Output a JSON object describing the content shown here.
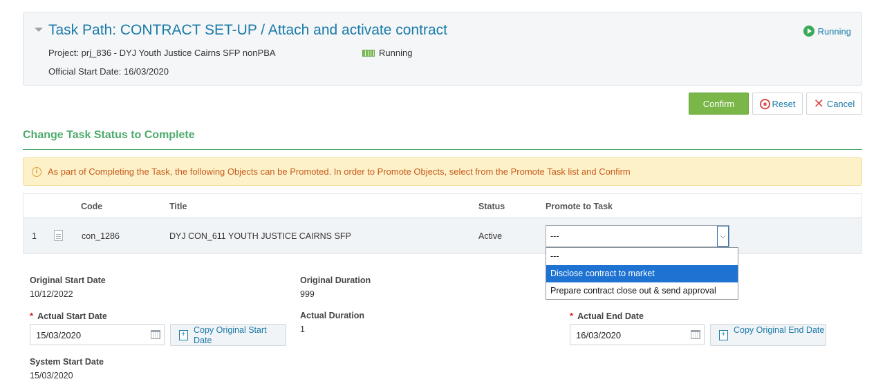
{
  "header": {
    "title": "Task Path: CONTRACT SET-UP / Attach and activate contract",
    "project": "Project: prj_836 - DYJ Youth Justice Cairns SFP nonPBA",
    "official_start": "Official Start Date: 16/03/2020",
    "status_mid": "Running",
    "status_top": "Running",
    "collapse_icon": "chevron-down-icon",
    "status_mid_icon": "battery-icon",
    "status_top_icon": "play-circle-icon"
  },
  "toolbar": {
    "confirm_label": "Confirm",
    "reset_label": "Reset",
    "cancel_label": "Cancel",
    "confirm_color": "#7ab648"
  },
  "section": {
    "title": "Change Task Status to Complete",
    "accent": "#4daa6b"
  },
  "alert": {
    "text": "As part of Completing the Task, the following Objects can be Promoted. In order to Promote Objects, select from the Promote Task list and Confirm",
    "icon": "info-icon"
  },
  "table": {
    "columns": [
      "Code",
      "Title",
      "Status",
      "Promote to Task"
    ],
    "rows": [
      {
        "num": "1",
        "icon": "document-icon",
        "code": "con_1286",
        "title": "DYJ CON_611 YOUTH JUSTICE CAIRNS SFP",
        "status": "Active",
        "promote_value": "---"
      }
    ]
  },
  "promote_dropdown": {
    "options": [
      "---",
      "Disclose contract to market",
      "Prepare contract close out & send approval"
    ],
    "highlighted": "Disclose contract to market"
  },
  "fields": {
    "original_start_label": "Original Start Date",
    "original_start_value": "10/12/2022",
    "original_duration_label": "Original Duration",
    "original_duration_value": "999",
    "actual_start_label": "Actual Start Date",
    "actual_start_value": "15/03/2020",
    "copy_original_start": "Copy Original Start Date",
    "actual_duration_label": "Actual Duration",
    "actual_duration_value": "1",
    "actual_end_label": "Actual End Date",
    "actual_end_value": "16/03/2020",
    "copy_original_end": "Copy Original End Date",
    "system_start_label": "System Start Date",
    "system_start_value": "15/03/2020",
    "required_marker": "*"
  }
}
